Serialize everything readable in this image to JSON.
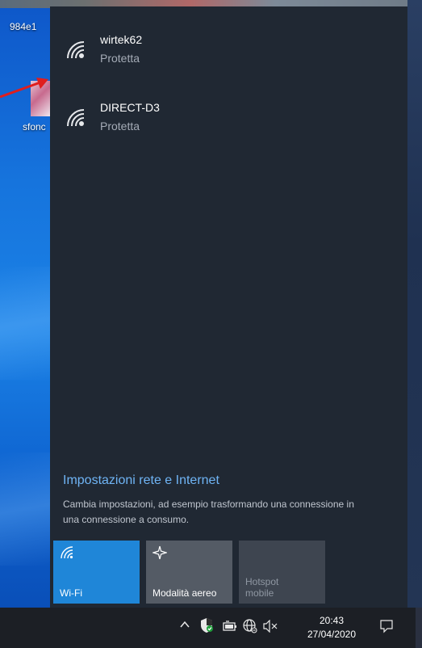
{
  "desktop": {
    "icons": [
      {
        "label": "984e1"
      },
      {
        "label": "sfonc"
      }
    ]
  },
  "networks": [
    {
      "name": "wirtek62",
      "status": "Protetta",
      "icon": "wifi-signal-icon"
    },
    {
      "name": "DIRECT-D3",
      "status": "Protetta",
      "icon": "wifi-signal-icon"
    }
  ],
  "settings": {
    "link": "Impostazioni rete e Internet",
    "description": "Cambia impostazioni, ad esempio trasformando una connessione in una connessione a consumo."
  },
  "quick_actions": {
    "wifi": {
      "label": "Wi-Fi",
      "icon": "wifi-icon",
      "state": "on"
    },
    "airplane": {
      "label": "Modalità aereo",
      "icon": "airplane-icon",
      "state": "off"
    },
    "hotspot": {
      "label_line1": "Hotspot",
      "label_line2": "mobile",
      "state": "disabled"
    }
  },
  "taskbar": {
    "time": "20:43",
    "date": "27/04/2020",
    "tray_icons": [
      "chevron-up-icon",
      "defender-shield-icon",
      "battery-icon",
      "globe-network-icon",
      "volume-muted-icon",
      "action-center-icon"
    ]
  },
  "colors": {
    "accent": "#1f86d8",
    "link": "#6fb4f5",
    "flyout_bg": "#202833",
    "annotation_arrow": "#e01e1e"
  }
}
